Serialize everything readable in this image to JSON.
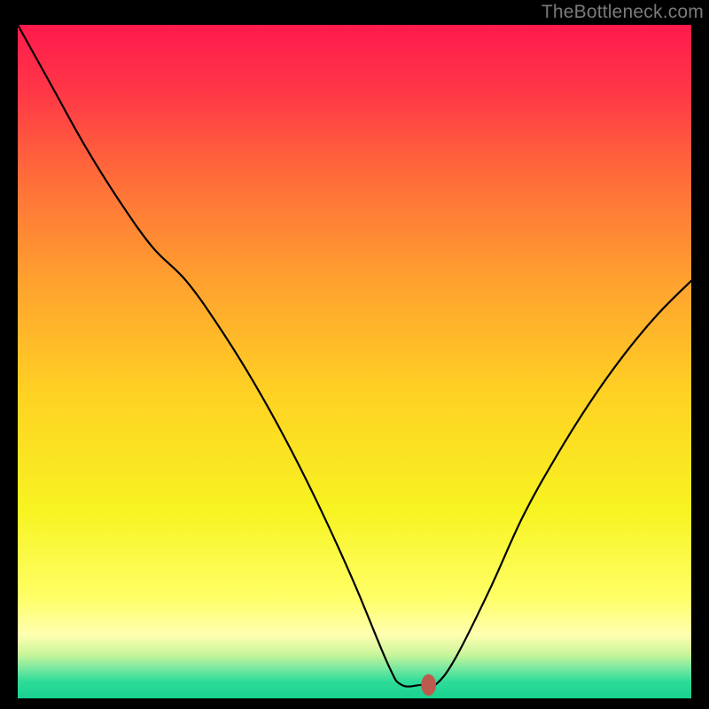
{
  "watermark": "TheBottleneck.com",
  "colors": {
    "page_bg": "#000000",
    "curve_stroke": "#000000",
    "marker_fill": "#bb5b4e",
    "gradient_stops": [
      {
        "offset": 0.0,
        "color": "#ff1a4d"
      },
      {
        "offset": 0.1,
        "color": "#ff3747"
      },
      {
        "offset": 0.22,
        "color": "#ff6a3a"
      },
      {
        "offset": 0.38,
        "color": "#ffa12f"
      },
      {
        "offset": 0.55,
        "color": "#ffd223"
      },
      {
        "offset": 0.72,
        "color": "#f7f321"
      },
      {
        "offset": 0.85,
        "color": "#ffff66"
      },
      {
        "offset": 0.905,
        "color": "#ffffb0"
      },
      {
        "offset": 0.935,
        "color": "#c9f59a"
      },
      {
        "offset": 0.955,
        "color": "#7be8a0"
      },
      {
        "offset": 0.975,
        "color": "#2fdc9a"
      },
      {
        "offset": 1.0,
        "color": "#18d18e"
      }
    ]
  },
  "chart_data": {
    "type": "line",
    "title": "",
    "xlabel": "",
    "ylabel": "",
    "xlim": [
      0,
      100
    ],
    "ylim": [
      0,
      100
    ],
    "grid": false,
    "legend": false,
    "series": [
      {
        "name": "bottleneck",
        "x": [
          0,
          5,
          10,
          15,
          20,
          25,
          30,
          35,
          40,
          45,
          50,
          55,
          57,
          60,
          62,
          65,
          70,
          75,
          80,
          85,
          90,
          95,
          100
        ],
        "values": [
          100,
          91,
          82,
          74,
          67,
          62,
          55,
          47,
          38,
          28,
          17,
          5,
          2,
          2,
          2,
          6,
          16,
          27,
          36,
          44,
          51,
          57,
          62
        ]
      }
    ],
    "marker": {
      "x": 61,
      "y": 2,
      "rx": 1.1,
      "ry": 1.6
    }
  }
}
